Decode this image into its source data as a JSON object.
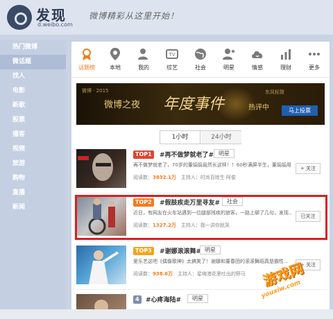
{
  "header": {
    "title": "发现",
    "subtitle": "d.weibo.com",
    "slogan": "微博精彩从这里开始！"
  },
  "sidebar": {
    "items": [
      {
        "label": "热门微博"
      },
      {
        "label": "微话题"
      },
      {
        "label": "找人"
      },
      {
        "label": "电影"
      },
      {
        "label": "新歌"
      },
      {
        "label": "股票"
      },
      {
        "label": "播客"
      },
      {
        "label": "视频"
      },
      {
        "label": "旅游"
      },
      {
        "label": "购物"
      },
      {
        "label": "直播"
      },
      {
        "label": "新闻"
      }
    ]
  },
  "topnav": {
    "items": [
      {
        "label": "话题榜",
        "icon": "award-icon"
      },
      {
        "label": "本地",
        "icon": "location-icon"
      },
      {
        "label": "我的",
        "icon": "user-icon"
      },
      {
        "label": "综艺",
        "icon": "tv-icon"
      },
      {
        "label": "社会",
        "icon": "globe-icon"
      },
      {
        "label": "明星",
        "icon": "star-icon"
      },
      {
        "label": "情感",
        "icon": "cloud-icon"
      },
      {
        "label": "理财",
        "icon": "chart-icon"
      },
      {
        "label": "更多",
        "icon": "more-icon"
      }
    ]
  },
  "banner": {
    "small": "微博 · 2015",
    "main1": "微博之夜",
    "main2": "年度事件",
    "main3": "热评中",
    "vote": "马上投票",
    "brand": "东风标致"
  },
  "tabs": {
    "tab1": "1小时",
    "tab2": "24小时"
  },
  "rows": [
    {
      "rank": "TOP1",
      "topic": "#再不做梦就老了#",
      "category": "明星",
      "desc": "再不做梦就老了，70岁的董娟娟竟然长这样！！60秒满屏半生，董娟娟用7...",
      "meta_label": "阅读数：",
      "reads": "3832.1万",
      "host": "主持人：时尚百姓生·阿俊",
      "button": "+ 关注"
    },
    {
      "rank": "TOP2",
      "topic": "#假肢疾走万里寻友#",
      "category": "社会",
      "desc": "近日，有网友在火车站遇到一位腿部残疾的旅客，一路上聊了几句，发现...",
      "meta_label": "阅读数：",
      "reads": "1327.2万",
      "host": "主持人：我一讲你就哭",
      "button": "已关注"
    },
    {
      "rank": "TOP3",
      "topic": "#谢娜滚滚舞#",
      "category": "明星",
      "desc": "爱乐艺这吧《偶像歌神》太搞笑了！谢娜和董春团的滚滚舞蹈真是霸性...",
      "meta_label": "阅读数：",
      "reads": "938.6万",
      "host": "主持人：星嗨港花里吐出的野马",
      "button": "+ 关注"
    },
    {
      "rank": "4",
      "topic": "#心疼海陆#",
      "category": "明星"
    }
  ],
  "watermark": {
    "line1": "游戏网",
    "line2": "youxiw.com"
  },
  "colors": {
    "accent": "#f07c20",
    "highlight": "#d9201f",
    "top1": "#e0452f",
    "top2": "#f07c20",
    "top3": "#f4a51c",
    "rank4": "#7f8fb0"
  }
}
